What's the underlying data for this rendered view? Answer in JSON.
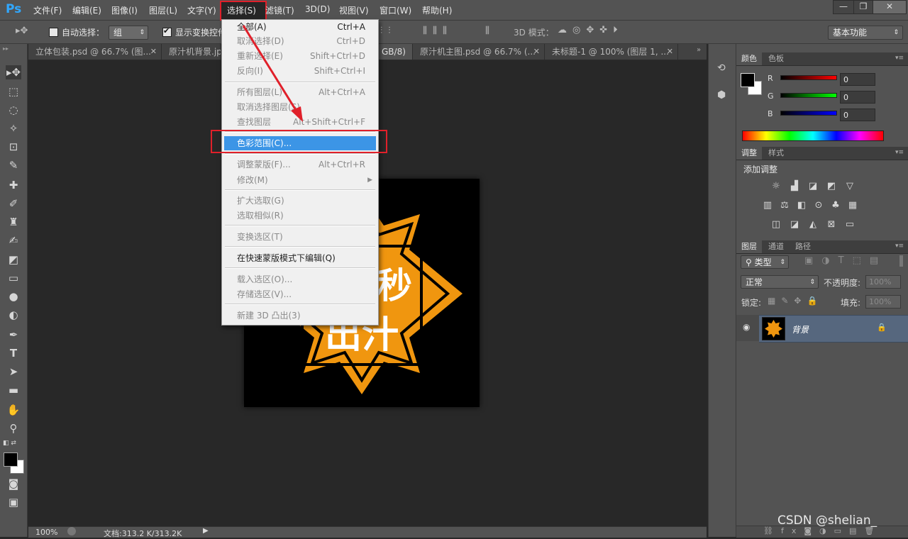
{
  "app": {
    "logo": "Ps"
  },
  "menubar": {
    "items": [
      "文件(F)",
      "编辑(E)",
      "图像(I)",
      "图层(L)",
      "文字(Y)",
      "选择(S)",
      "滤镜(T)",
      "3D(D)",
      "视图(V)",
      "窗口(W)",
      "帮助(H)"
    ],
    "window_buttons": [
      "—",
      "❐",
      "✕"
    ]
  },
  "options": {
    "auto_select_label": "自动选择：",
    "auto_select_value": "组",
    "show_transform_label": "显示变换控件",
    "mode3d_label": "3D 模式：",
    "workspace": "基本功能"
  },
  "tabs": [
    "立体包装.psd @ 66.7% (图...",
    "原汁机背景.jpg",
    "GB/8)",
    "原汁机主图.psd @ 66.7% (...",
    "未标题-1 @ 100% (图层 1, ..."
  ],
  "dropdown": {
    "items": [
      {
        "label": "全部(A)",
        "shortcut": "Ctrl+A",
        "disabled": false
      },
      {
        "label": "取消选择(D)",
        "shortcut": "Ctrl+D",
        "disabled": true
      },
      {
        "label": "重新选择(E)",
        "shortcut": "Shift+Ctrl+D",
        "disabled": true
      },
      {
        "label": "反向(I)",
        "shortcut": "Shift+Ctrl+I",
        "disabled": true
      },
      {
        "label": "所有图层(L)",
        "shortcut": "Alt+Ctrl+A",
        "disabled": true
      },
      {
        "label": "取消选择图层(S)",
        "shortcut": "",
        "disabled": true
      },
      {
        "label": "查找图层",
        "shortcut": "Alt+Shift+Ctrl+F",
        "disabled": true
      },
      {
        "label": "色彩范围(C)...",
        "shortcut": "",
        "disabled": false,
        "highlighted": true
      },
      {
        "label": "调整蒙版(F)...",
        "shortcut": "Alt+Ctrl+R",
        "disabled": true
      },
      {
        "label": "修改(M)",
        "shortcut": "",
        "disabled": true,
        "submenu": true
      },
      {
        "label": "扩大选取(G)",
        "shortcut": "",
        "disabled": true
      },
      {
        "label": "选取相似(R)",
        "shortcut": "",
        "disabled": true
      },
      {
        "label": "变换选区(T)",
        "shortcut": "",
        "disabled": true
      },
      {
        "label": "在快速蒙版模式下编辑(Q)",
        "shortcut": "",
        "disabled": false
      },
      {
        "label": "载入选区(O)...",
        "shortcut": "",
        "disabled": true
      },
      {
        "label": "存储选区(V)...",
        "shortcut": "",
        "disabled": true
      },
      {
        "label": "新建 3D 凸出(3)",
        "shortcut": "",
        "disabled": true
      }
    ]
  },
  "document": {
    "text_top": "秒",
    "text_bottom": "出汁"
  },
  "status": {
    "zoom": "100%",
    "doc_info": "文档:313.2 K/313.2K"
  },
  "color_panel": {
    "tabs": [
      "颜色",
      "色板"
    ],
    "channels": [
      {
        "label": "R",
        "value": "0"
      },
      {
        "label": "G",
        "value": "0"
      },
      {
        "label": "B",
        "value": "0"
      }
    ]
  },
  "adjust_panel": {
    "tabs": [
      "调整",
      "样式"
    ],
    "title": "添加调整"
  },
  "layers_panel": {
    "tabs": [
      "图层",
      "通道",
      "路径"
    ],
    "filter_type": "类型",
    "blend_mode": "正常",
    "opacity_label": "不透明度:",
    "opacity_value": "100%",
    "lock_label": "锁定:",
    "fill_label": "填充:",
    "fill_value": "100%",
    "layer_name": "背景"
  },
  "watermark": "CSDN @shelian_",
  "colors": {
    "highlight": "#3c95e6",
    "annotation": "#e0202a",
    "badge_orange": "#f0960f"
  }
}
